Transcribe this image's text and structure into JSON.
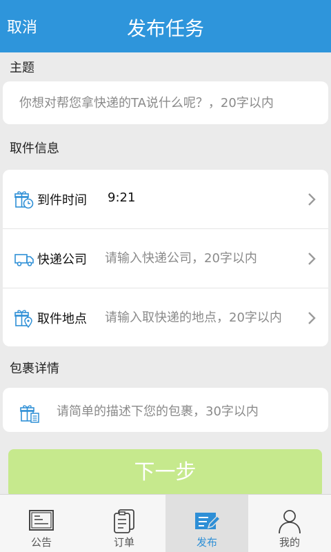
{
  "header": {
    "cancel_label": "取消",
    "title": "发布任务"
  },
  "topic": {
    "section_label": "主题",
    "placeholder": "你想对帮您拿快递的TA说什么呢？，20字以内"
  },
  "pickup": {
    "section_label": "取件信息",
    "rows": [
      {
        "icon": "gift-clock-icon",
        "label": "到件时间",
        "value": "9:21"
      },
      {
        "icon": "truck-icon",
        "label": "快递公司",
        "placeholder": "请输入快递公司，20字以内"
      },
      {
        "icon": "gift-location-icon",
        "label": "取件地点",
        "placeholder": "请输入取快递的地点，20字以内"
      }
    ]
  },
  "package": {
    "section_label": "包裹详情",
    "icon": "gift-list-icon",
    "placeholder": "请简单的描述下您的包裹，30字以内"
  },
  "next_button": {
    "label": "下一步",
    "color": "#c6e98d"
  },
  "tabbar": {
    "tabs": [
      {
        "icon": "bulletin-icon",
        "label": "公告",
        "active": false
      },
      {
        "icon": "orders-icon",
        "label": "订单",
        "active": false
      },
      {
        "icon": "publish-icon",
        "label": "发布",
        "active": true
      },
      {
        "icon": "profile-icon",
        "label": "我的",
        "active": false
      }
    ]
  },
  "colors": {
    "header": "#2e95db",
    "accent_icon": "#2e8fd6",
    "background": "#ebebeb"
  }
}
